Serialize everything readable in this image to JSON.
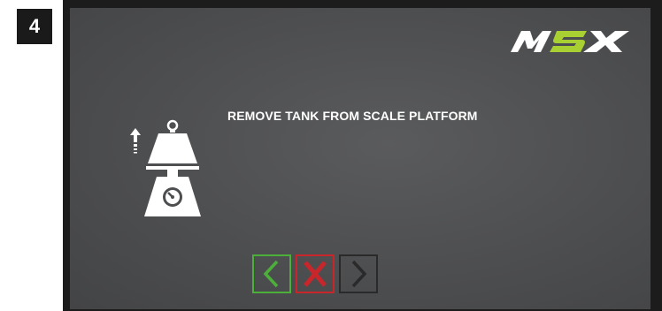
{
  "step": {
    "number": "4"
  },
  "brand": {
    "logo_text": "MSX",
    "logo_colors": {
      "letters": "#ffffff",
      "accent": "#a8d032"
    }
  },
  "screen": {
    "instruction": "REMOVE TANK FROM SCALE PLATFORM",
    "graphic": {
      "icon": "tank-on-scale-lift-icon",
      "color": "#ffffff"
    }
  },
  "nav": {
    "buttons": [
      {
        "id": "back",
        "icon": "chevron-left-icon",
        "color": "#4caf3a"
      },
      {
        "id": "cancel",
        "icon": "close-x-icon",
        "color": "#c8262a"
      },
      {
        "id": "next",
        "icon": "chevron-right-icon",
        "color": "#2a2a2a"
      }
    ]
  }
}
